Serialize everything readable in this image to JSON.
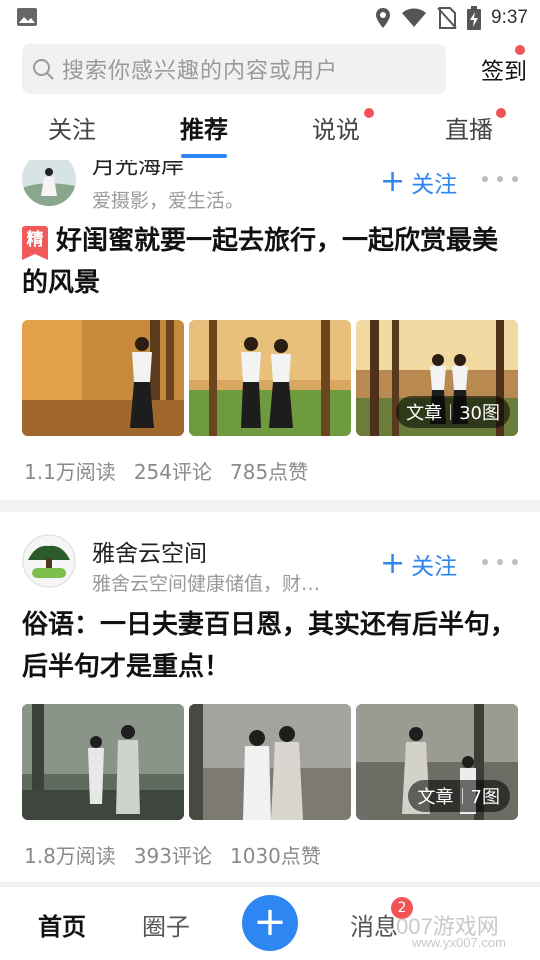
{
  "status_bar": {
    "time": "9:37"
  },
  "search": {
    "placeholder": "搜索你感兴趣的内容或用户",
    "signin_label": "签到"
  },
  "tabs": [
    {
      "label": "关注"
    },
    {
      "label": "推荐",
      "active": true
    },
    {
      "label": "说说",
      "dot": true
    },
    {
      "label": "直播",
      "dot": true
    }
  ],
  "posts": [
    {
      "author": "月光海岸",
      "author_desc": "爱摄影，爱生活。",
      "follow_label": "关注",
      "featured_label": "精",
      "title": "好闺蜜就要一起去旅行，一起欣赏最美的风景",
      "image_badge": {
        "type": "文章",
        "count": "30图"
      },
      "stats": {
        "reads": "1.1万阅读",
        "comments": "254评论",
        "likes": "785点赞"
      }
    },
    {
      "author": "雅舍云空间",
      "author_desc": "雅舍云空间健康储值，财…",
      "follow_label": "关注",
      "title": "俗语：一日夫妻百日恩，其实还有后半句，后半句才是重点！",
      "image_badge": {
        "type": "文章",
        "count": "7图"
      },
      "stats": {
        "reads": "1.8万阅读",
        "comments": "393评论",
        "likes": "1030点赞"
      }
    }
  ],
  "bottom_nav": {
    "home": "首页",
    "circle": "圈子",
    "add": "+",
    "messages": "消息",
    "messages_badge": "2",
    "watermark": "007游戏网",
    "watermark_url": "www.yx007.com"
  },
  "colors": {
    "accent": "#2e86f2",
    "red_dot": "#f25356",
    "featured": "#f05a5a"
  }
}
